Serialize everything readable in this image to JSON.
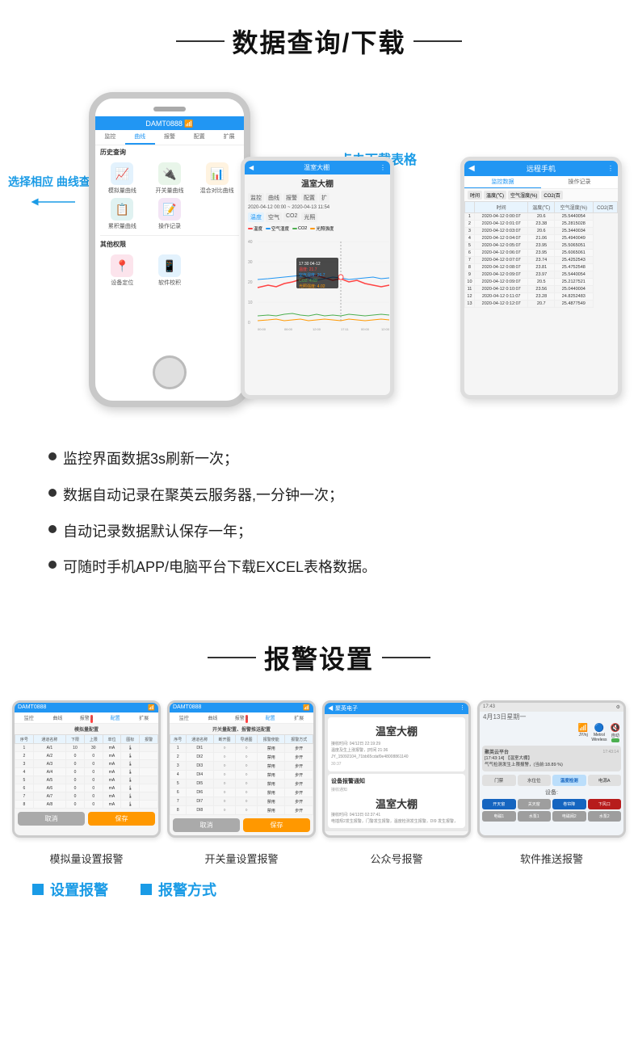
{
  "section1": {
    "title": "数据查询/下载",
    "label_left": "选择相应\n曲线查询",
    "label_top": "点击下载表格",
    "phone1": {
      "header": "DAMT0888",
      "nav": [
        "监控",
        "曲线",
        "报警",
        "配置",
        "扩展"
      ],
      "history_label": "历史查询",
      "items": [
        {
          "icon": "📈",
          "label": "模拟量曲线",
          "color": "blue"
        },
        {
          "icon": "🔌",
          "label": "开关量曲线",
          "color": "green"
        },
        {
          "icon": "📊",
          "label": "混合对比曲线",
          "color": "orange"
        },
        {
          "icon": "📋",
          "label": "累积量曲线",
          "color": "teal"
        },
        {
          "icon": "📝",
          "label": "操作记录",
          "color": "purple"
        }
      ],
      "other_label": "其他权限",
      "other_items": [
        {
          "icon": "📍",
          "label": "设备定位",
          "color": "red"
        },
        {
          "icon": "📱",
          "label": "软件校积",
          "color": "blue"
        }
      ]
    },
    "phone2": {
      "header": "温室大棚",
      "controls": [
        "监控",
        "曲线",
        "报警",
        "配置",
        "扩"
      ],
      "date": "2020-04-12 00:00",
      "to": "2020-04-13 11:54",
      "channels": [
        "温度",
        "空气",
        "CO2",
        "光照"
      ],
      "legend": [
        {
          "label": "温度",
          "color": "#f44"
        },
        {
          "label": "空气湿度",
          "color": "#2196f3"
        },
        {
          "label": "CO2",
          "color": "#4caf50"
        },
        {
          "label": "光照强度",
          "color": "#ff9800"
        }
      ],
      "tooltip": {
        "time": "17:30 04-12",
        "temp": "温度: 21.7",
        "humidity": "空气湿度: 26.7",
        "co2": "CO2: 4.69",
        "light": "光照强度: 4.02"
      }
    },
    "phone3": {
      "header": "远程手机",
      "tabs": [
        "监控数据",
        "操作记录"
      ],
      "filters": [
        "时间",
        "温度(℃)",
        "空气湿度(%)",
        "CO2(百"
      ],
      "data": [
        [
          "1",
          "2020-04-12 0:00:07",
          "20.6",
          "25.5440054"
        ],
        [
          "2",
          "2020-04-12 0:01:07",
          "23.38",
          "25.2815028"
        ],
        [
          "3",
          "2020-04-12 0:03:07",
          "20.6",
          "25.3440034"
        ],
        [
          "4",
          "2020-04-12 0:04:07",
          "21.06",
          "25.4940049"
        ],
        [
          "5",
          "2020-04-12 0:05:07",
          "23.95",
          "25.5065051"
        ],
        [
          "6",
          "2020-04-12 0:06:07",
          "23.95",
          "25.6065061"
        ],
        [
          "7",
          "2020-04-12 0:07:07",
          "23.74",
          "25.4252543"
        ],
        [
          "8",
          "2020-04-12 0:08:07",
          "23.81",
          "25.4752548"
        ],
        [
          "9",
          "2020-04-12 0:09:07",
          "23.97",
          "25.5440054"
        ],
        [
          "10",
          "2020-04-12 0:09:07",
          "20.5",
          "25.2127521"
        ],
        [
          "11",
          "2020-04-12 0:10:07",
          "23.56",
          "25.0440004"
        ],
        [
          "12",
          "2020-04-12 0:11:07",
          "23.28",
          "24.8252483"
        ],
        [
          "13",
          "2020-04-12 0:12:07",
          "20.7",
          "25.4877549"
        ]
      ]
    }
  },
  "bullets": [
    "监控界面数据3s刷新一次；",
    "数据自动记录在聚英云服务器,一分钟一次；",
    "自动记录数据默认保存一年；",
    "可随时手机APP/电脑平台下载EXCEL表格数据。"
  ],
  "section2": {
    "title": "报警设置",
    "alarm_phones": [
      {
        "header": "DAMT0888",
        "subtitle": "模拟量设置报警",
        "table_title": "模拟量配置",
        "headers": [
          "序号",
          "通道名称",
          "下限报警",
          "上限报警",
          "单位",
          "图标",
          "报警方式"
        ],
        "rows": [
          [
            "1",
            "A/1",
            "10",
            "30",
            "mA",
            "🌡"
          ],
          [
            "2",
            "A/2",
            "0",
            "0",
            "mA",
            "🌡"
          ],
          [
            "3",
            "A/3",
            "0",
            "0",
            "mA",
            "🌡"
          ],
          [
            "4",
            "A/4",
            "0",
            "0",
            "mA",
            "🌡"
          ],
          [
            "5",
            "A/5",
            "0",
            "0",
            "mA",
            "🌡"
          ],
          [
            "6",
            "A/6",
            "0",
            "0",
            "mA",
            "🌡"
          ],
          [
            "7",
            "A/7",
            "0",
            "0",
            "mA",
            "🌡"
          ],
          [
            "8",
            "A/8",
            "0",
            "0",
            "mA",
            "🌡"
          ]
        ]
      },
      {
        "header": "DAMT0888",
        "subtitle": "开关量设置报警",
        "table_title": "开关量配置、报警推送配置",
        "headers": [
          "序号",
          "通道名称",
          "断开图",
          "导通图",
          "报警使能",
          "报警方式"
        ],
        "rows": [
          [
            "1",
            "DI1",
            "○",
            "○",
            "禁用",
            "步开"
          ],
          [
            "2",
            "DI2",
            "○",
            "○",
            "禁用",
            "步开"
          ],
          [
            "3",
            "DI3",
            "○",
            "○",
            "禁用",
            "步开"
          ],
          [
            "4",
            "DI4",
            "○",
            "○",
            "禁用",
            "步开"
          ],
          [
            "5",
            "DI5",
            "○",
            "○",
            "禁用",
            "步开"
          ],
          [
            "6",
            "DI6",
            "○",
            "○",
            "禁用",
            "步开"
          ],
          [
            "7",
            "DI7",
            "○",
            "○",
            "禁用",
            "步开"
          ],
          [
            "8",
            "DI8",
            "○",
            "○",
            "禁用",
            "步开"
          ]
        ]
      },
      {
        "header": "聚英电子",
        "device_name": "温室大棚",
        "subtitle": "公众号报警",
        "info_time1": "接收时间: 04/12日 22:19:29",
        "info_text1": "温度及生上涨报警，[时间 21:36",
        "info_text2": "JY_15092104_71bb65cdaf0e48008861140",
        "notify_title": "设备报警通知",
        "info_time2": "04/13日 02:37:41",
        "info_text3": "电插规2发生报警，门警发生报警，温度检测发生报警，DI9 发生报警，"
      },
      {
        "subtitle": "软件推送报警",
        "time": "17:43",
        "date": "4月13日星期一",
        "wifi_label": "JY/nj",
        "bt_label": "Metrol\nWireless",
        "notification_app": "聚英云平台",
        "notification_title": "[17:43:14] 【温室大棚】",
        "notification_text": "气气检测发生上限报警，(当前:18.89 %)",
        "buttons": [
          "门禁",
          "水位位",
          "温度检测",
          "电源A"
        ],
        "btn_highlight": "温度检测",
        "controls": [
          "开天窗",
          "关天窗",
          "卷帘降",
          "下风口",
          "电磁1",
          "水泵1",
          "电磁阀2",
          "水泵2"
        ]
      }
    ],
    "captions": [
      "模拟量设置报警",
      "开关量设置报警",
      "公众号报警",
      "软件推送报警"
    ],
    "bottom_labels": [
      "设置报警",
      "报警方式"
    ]
  }
}
